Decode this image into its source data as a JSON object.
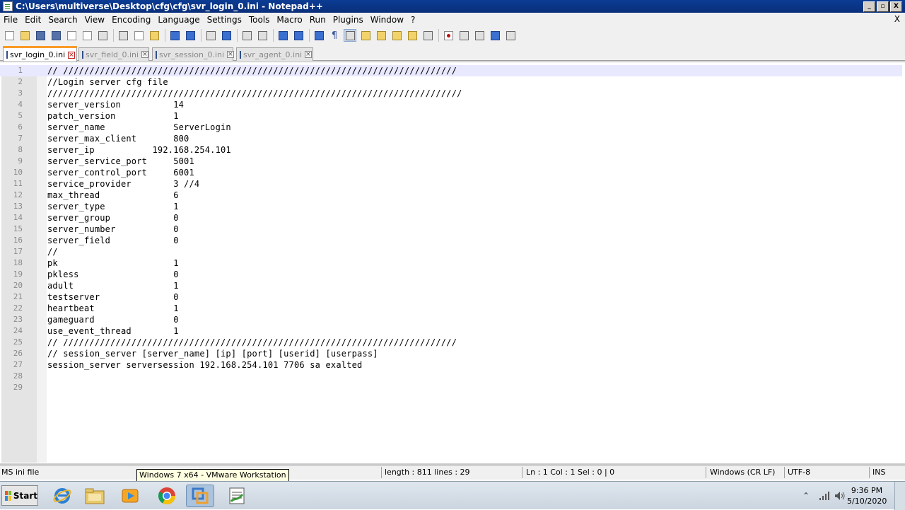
{
  "window": {
    "title": "C:\\Users\\multiverse\\Desktop\\cfg\\cfg\\svr_login_0.ini - Notepad++",
    "controls": {
      "minimize": "_",
      "restore": "▫",
      "close": "X"
    }
  },
  "menu": {
    "items": [
      "File",
      "Edit",
      "Search",
      "View",
      "Encoding",
      "Language",
      "Settings",
      "Tools",
      "Macro",
      "Run",
      "Plugins",
      "Window",
      "?"
    ],
    "close_doc": "X"
  },
  "toolbar": {
    "icons": [
      "new-file",
      "open-file",
      "save",
      "save-all",
      "close",
      "close-all",
      "print",
      "cut",
      "copy",
      "paste",
      "undo",
      "redo",
      "find",
      "replace",
      "zoom-in",
      "zoom-out",
      "sync-vertical",
      "sync-horizontal",
      "word-wrap",
      "show-all-characters",
      "indent-guide",
      "user-defined-language",
      "document-map",
      "function-list",
      "folder-as-workspace",
      "monitoring",
      "record-macro",
      "stop-recording",
      "playback-macro",
      "run-macro-multiple",
      "save-macro"
    ]
  },
  "tabs": [
    {
      "label": "svr_login_0.ini",
      "active": true
    },
    {
      "label": "svr_field_0.ini",
      "active": false
    },
    {
      "label": "svr_session_0.ini",
      "active": false
    },
    {
      "label": "svr_agent_0.ini",
      "active": false
    }
  ],
  "editor": {
    "current_line": 1,
    "lines": [
      "// ///////////////////////////////////////////////////////////////////////////",
      "//Login server cfg file",
      "///////////////////////////////////////////////////////////////////////////////",
      "server_version          14",
      "patch_version           1",
      "server_name             ServerLogin",
      "server_max_client       800",
      "server_ip           192.168.254.101",
      "server_service_port     5001",
      "server_control_port     6001",
      "service_provider        3 //4",
      "max_thread              6",
      "server_type             1",
      "server_group            0",
      "server_number           0",
      "server_field            0",
      "//",
      "pk                      1",
      "pkless                  0",
      "adult                   1",
      "testserver              0",
      "heartbeat               1",
      "gameguard               0",
      "use_event_thread        1",
      "// ///////////////////////////////////////////////////////////////////////////",
      "// session_server [server_name] [ip] [port] [userid] [userpass]",
      "session_server serversession 192.168.254.101 7706 sa exalted",
      "",
      ""
    ]
  },
  "status": {
    "file_type": "MS ini file",
    "length_lines": "length : 811    lines : 29",
    "position": "Ln : 1    Col : 1    Sel : 0 | 0",
    "eol": "Windows (CR LF)",
    "encoding": "UTF-8",
    "mode": "INS"
  },
  "tooltip": "Windows 7 x64 - VMware Workstation",
  "taskbar": {
    "start_label": "Start",
    "apps": [
      "internet-explorer-icon",
      "file-explorer-icon",
      "media-player-icon",
      "chrome-icon",
      "vmware-icon",
      "notepad-plus-plus-icon"
    ],
    "clock_time": "9:36 PM",
    "clock_date": "5/10/2020"
  }
}
